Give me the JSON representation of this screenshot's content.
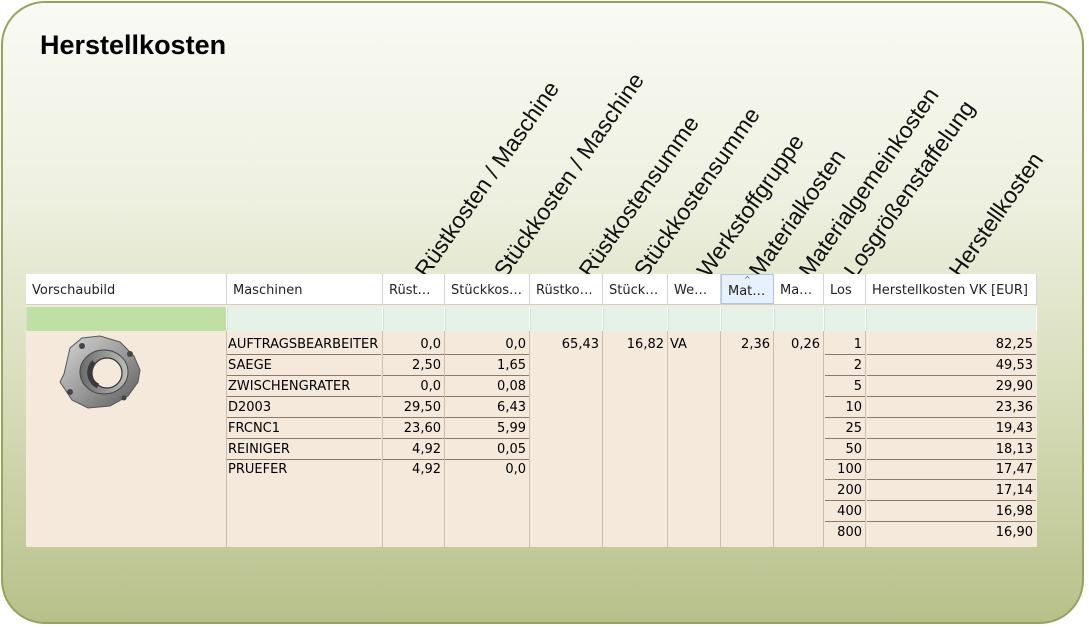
{
  "title": "Herstellkosten",
  "rotated_headers": [
    "Rüstkosten / Maschine",
    "Stückkosten / Maschine",
    "Rüstkostensumme",
    "Stückkostensumme",
    "Werkstoffgruppe",
    "Materialkosten",
    "Materialgemeinkosten",
    "Losgrößenstaffelung",
    "Herstellkosten"
  ],
  "columns": [
    "Vorschaubild",
    "Maschinen",
    "Rüst…",
    "Stückkos…",
    "Rüstko…",
    "Stück…",
    "We…",
    "Mat…",
    "Ma…",
    "Los",
    "Herstellkosten VK [EUR]"
  ],
  "machines": [
    {
      "name": "AUFTRAGSBEARBEITER",
      "setup": "0,0",
      "unit": "0,0"
    },
    {
      "name": "SAEGE",
      "setup": "2,50",
      "unit": "1,65"
    },
    {
      "name": "ZWISCHENGRATER",
      "setup": "0,0",
      "unit": "0,08"
    },
    {
      "name": "D2003",
      "setup": "29,50",
      "unit": "6,43"
    },
    {
      "name": "FRCNC1",
      "setup": "23,60",
      "unit": "5,99"
    },
    {
      "name": "REINIGER",
      "setup": "4,92",
      "unit": "0,05"
    },
    {
      "name": "PRUEFER",
      "setup": "4,92",
      "unit": "0,0"
    }
  ],
  "summary": {
    "setup_sum": "65,43",
    "unit_sum": "16,82",
    "material_group": "VA",
    "material_cost": "2,36",
    "material_overhead": "0,26"
  },
  "lots": [
    {
      "lot": "1",
      "cost": "82,25"
    },
    {
      "lot": "2",
      "cost": "49,53"
    },
    {
      "lot": "5",
      "cost": "29,90"
    },
    {
      "lot": "10",
      "cost": "23,36"
    },
    {
      "lot": "25",
      "cost": "19,43"
    },
    {
      "lot": "50",
      "cost": "18,13"
    },
    {
      "lot": "100",
      "cost": "17,47"
    },
    {
      "lot": "200",
      "cost": "17,14"
    },
    {
      "lot": "400",
      "cost": "16,98"
    },
    {
      "lot": "800",
      "cost": "16,90"
    }
  ],
  "colors": {
    "header_bg": "#ffffff",
    "filter_bg": "#e4f2e8",
    "preview_filter_bg": "#bfe0a3",
    "body_bg": "#f5e9dc"
  }
}
